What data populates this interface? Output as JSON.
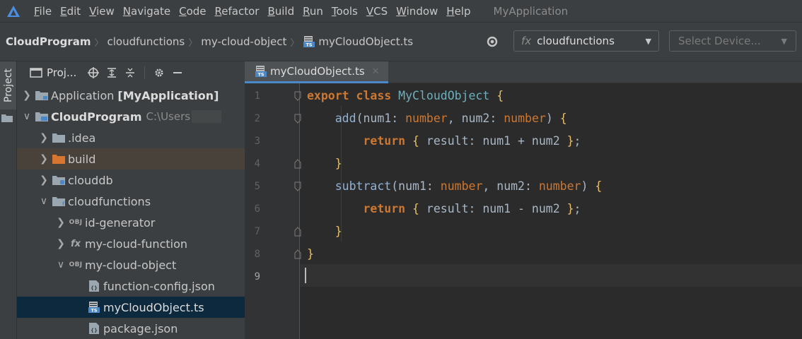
{
  "menu": {
    "items": [
      "File",
      "Edit",
      "View",
      "Navigate",
      "Code",
      "Refactor",
      "Build",
      "Run",
      "Tools",
      "VCS",
      "Window",
      "Help"
    ],
    "project_title": "MyApplication"
  },
  "breadcrumb": {
    "items": [
      "CloudProgram",
      "cloudfunctions",
      "my-cloud-object",
      "myCloudObject.ts"
    ]
  },
  "toolbar": {
    "function_prefix": "fx",
    "function_select": "cloudfunctions",
    "device_select": "Select Device..."
  },
  "side_stripe": {
    "project_tab": "Project"
  },
  "project_panel": {
    "title": "Proj...",
    "tree": [
      {
        "label": "Application",
        "suffix": "[MyApplication]",
        "icon": "module-folder-icon",
        "expanded": false
      },
      {
        "label": "CloudProgram",
        "dim": "C:\\Users",
        "icon": "cloud-module-folder-icon",
        "expanded": true
      },
      {
        "label": ".idea",
        "icon": "folder-icon",
        "expanded": false
      },
      {
        "label": "build",
        "icon": "excluded-folder-icon",
        "expanded": false
      },
      {
        "label": "clouddb",
        "icon": "db-folder-icon",
        "expanded": false
      },
      {
        "label": "cloudfunctions",
        "icon": "functions-folder-icon",
        "expanded": true
      },
      {
        "label": "id-generator",
        "icon": "cloud-object-icon",
        "badge": "OBJ",
        "expanded": false
      },
      {
        "label": "my-cloud-function",
        "icon": "cloud-function-icon",
        "badge": "fx",
        "expanded": false
      },
      {
        "label": "my-cloud-object",
        "icon": "cloud-object-icon",
        "badge": "OBJ",
        "expanded": true
      },
      {
        "label": "function-config.json",
        "icon": "json-file-icon"
      },
      {
        "label": "myCloudObject.ts",
        "icon": "ts-file-icon",
        "selected": true
      },
      {
        "label": "package.json",
        "icon": "json-file-icon"
      }
    ]
  },
  "editor": {
    "tab_label": "myCloudObject.ts",
    "line_numbers": [
      "1",
      "2",
      "3",
      "4",
      "5",
      "6",
      "7",
      "8",
      "9"
    ],
    "current_line": "9"
  },
  "colors": {
    "keyword": "#cc7832",
    "class_name": "#6fafbd",
    "method": "#8fb2d8",
    "code_text": "#a9b7c6",
    "selection": "#0d293e",
    "excluded_row": "#49423a"
  }
}
